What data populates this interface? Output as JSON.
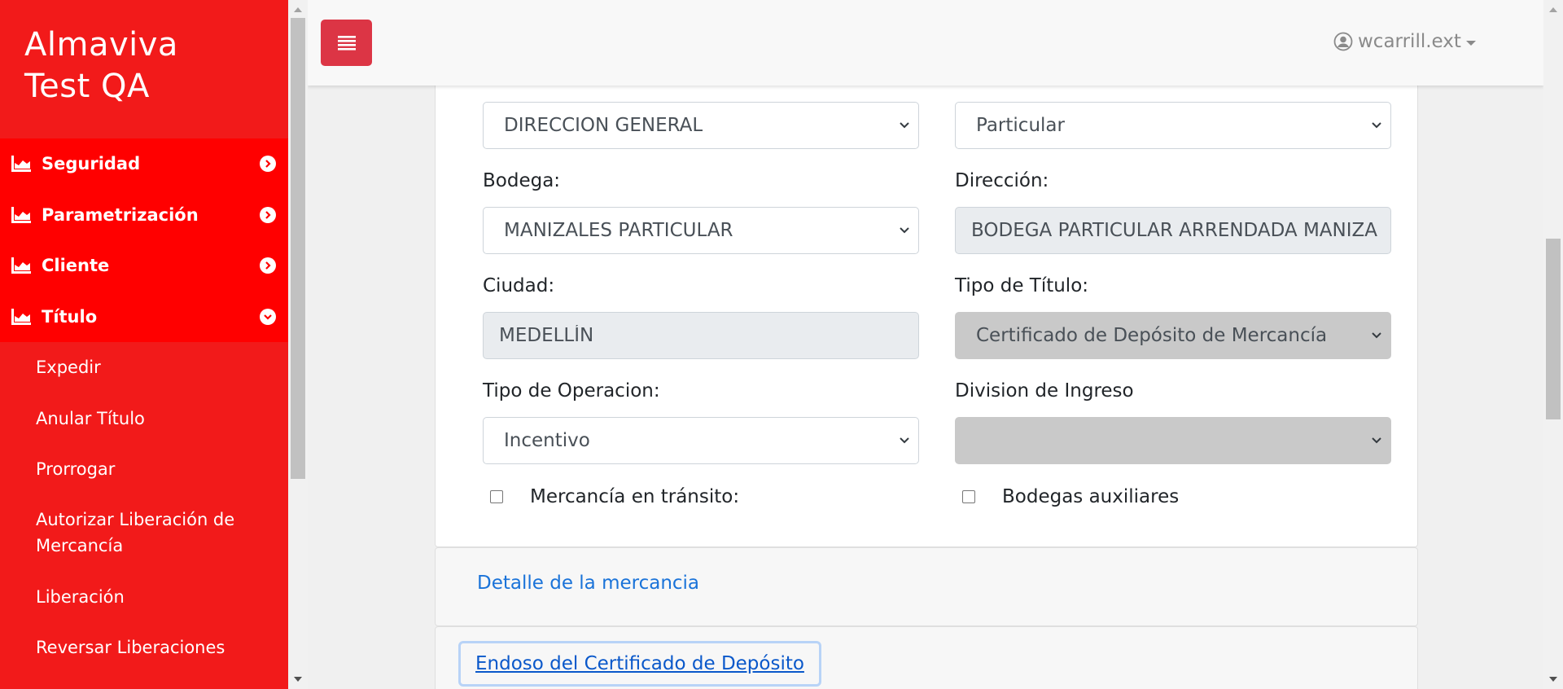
{
  "brand": {
    "line1": "Almaviva",
    "line2": "Test QA"
  },
  "sidebar": {
    "items": [
      {
        "label": "Seguridad",
        "icon": "chart-icon",
        "expanded": false
      },
      {
        "label": "Parametrización",
        "icon": "chart-icon",
        "expanded": false
      },
      {
        "label": "Cliente",
        "icon": "chart-icon",
        "expanded": false
      },
      {
        "label": "Título",
        "icon": "chart-icon",
        "expanded": true
      }
    ],
    "submenu": [
      "Expedir",
      "Anular Título",
      "Prorrogar",
      "Autorizar Liberación de Mercancía",
      "Liberación",
      "Reversar Liberaciones"
    ]
  },
  "header": {
    "user": "wcarrill.ext"
  },
  "form": {
    "row0": {
      "left_value": "DIRECCION GENERAL",
      "right_value": "Particular"
    },
    "bodega": {
      "label": "Bodega:",
      "value": "MANIZALES PARTICULAR"
    },
    "direccion": {
      "label": "Dirección:",
      "value": "BODEGA PARTICULAR ARRENDADA MANIZALES"
    },
    "ciudad": {
      "label": "Ciudad:",
      "value": "MEDELLÍN"
    },
    "tipo_titulo": {
      "label": "Tipo de Título:",
      "value": "Certificado de Depósito de Mercancía"
    },
    "tipo_operacion": {
      "label": "Tipo de Operacion:",
      "value": "Incentivo"
    },
    "division_ingreso": {
      "label": "Division de Ingreso",
      "value": ""
    },
    "mercancia_transito": {
      "label": "Mercancía en tránsito:",
      "checked": false
    },
    "bodegas_auxiliares": {
      "label": "Bodegas auxiliares",
      "checked": false
    }
  },
  "accordion": {
    "detalle": "Detalle de la mercancia",
    "endoso": "Endoso del Certificado de Depósito"
  },
  "colors": {
    "sidebar_bg": "#f21a1a",
    "menu_bg": "#ff0000",
    "toggle_button": "#dc3545",
    "link": "#1a73d9"
  }
}
